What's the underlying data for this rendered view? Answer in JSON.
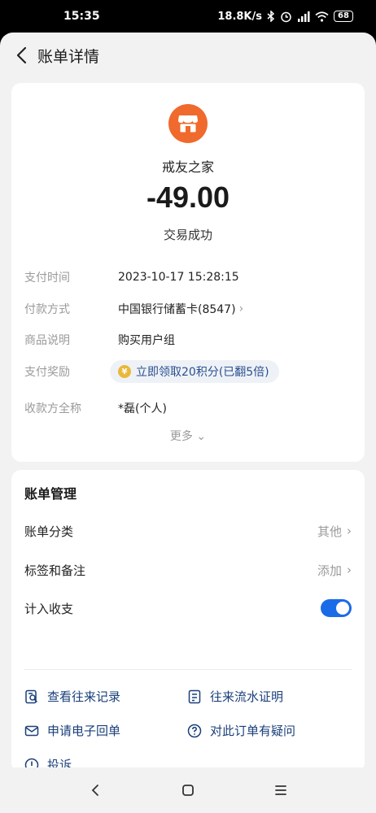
{
  "status_bar": {
    "time": "15:35",
    "net_speed": "18.8K/s",
    "battery": "68"
  },
  "header": {
    "title": "账单详情"
  },
  "summary": {
    "merchant_name": "戒友之家",
    "amount": "-49.00",
    "status": "交易成功",
    "merchant_icon_color": "#f06a2d"
  },
  "details": {
    "pay_time_label": "支付时间",
    "pay_time_value": "2023-10-17 15:28:15",
    "pay_method_label": "付款方式",
    "pay_method_value": "中国银行储蓄卡(8547)",
    "goods_label": "商品说明",
    "goods_value": "购买用户组",
    "reward_label": "支付奖励",
    "reward_value": "立即领取20积分(已翻5倍)",
    "payee_label": "收款方全称",
    "payee_value": "*磊(个人)",
    "more_label": "更多"
  },
  "management": {
    "title": "账单管理",
    "category_label": "账单分类",
    "category_value": "其他",
    "tags_label": "标签和备注",
    "tags_value": "添加",
    "include_label": "计入收支",
    "include_enabled": true,
    "accent_color": "#1a6be8"
  },
  "links": {
    "history": "查看往来记录",
    "flow_proof": "往来流水证明",
    "e_receipt": "申请电子回单",
    "question": "对此订单有疑问",
    "complaint": "投诉"
  }
}
